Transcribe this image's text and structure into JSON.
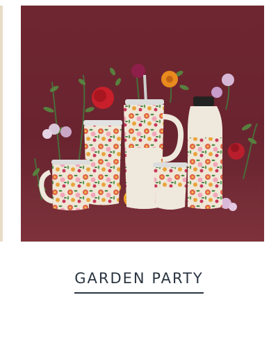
{
  "collection": {
    "title": "GARDEN PARTY",
    "image_alt": "",
    "colors": {
      "backdrop": "#6e2730",
      "title_text": "#2a3440",
      "drinkware_body": "#efe8dc"
    },
    "products": [
      {
        "kind": "mug",
        "icon": "mug-icon"
      },
      {
        "kind": "tall-tumbler",
        "icon": "tumbler-icon"
      },
      {
        "kind": "quencher-with-straw",
        "icon": "quencher-icon"
      },
      {
        "kind": "stemless-cup",
        "icon": "cup-icon"
      },
      {
        "kind": "canteen-bottle",
        "icon": "bottle-icon"
      }
    ]
  }
}
